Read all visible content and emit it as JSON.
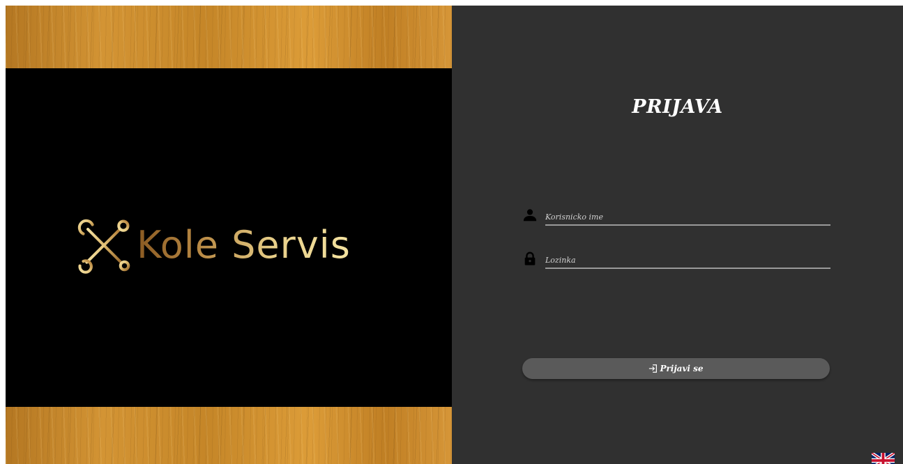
{
  "brand": {
    "logo_text": "Kole Servis",
    "logo_icon": "crossed-wrenches-icon"
  },
  "login": {
    "title": "PRIJAVA",
    "username": {
      "icon": "user-icon",
      "placeholder": "Korisnicko ime",
      "value": ""
    },
    "password": {
      "icon": "lock-icon",
      "placeholder": "Lozinka",
      "value": ""
    },
    "submit": {
      "icon": "sign-in-icon",
      "label": "Prijavi se"
    }
  },
  "language": {
    "icon": "uk-flag-icon"
  },
  "colors": {
    "panel_bg": "#303030",
    "button_bg": "#5a5a5a",
    "logo_gold": "#e8d08a",
    "wood": "#c88a28"
  }
}
